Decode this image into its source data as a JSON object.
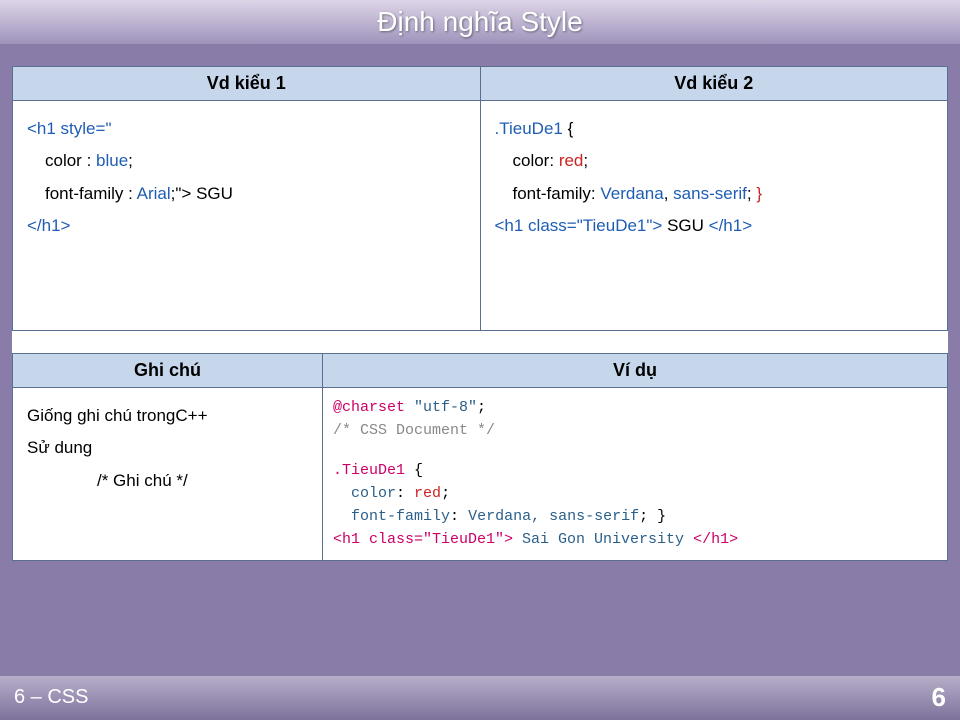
{
  "title": "Định nghĩa Style",
  "footer_left": "6 – CSS",
  "page_number": "6",
  "table1": {
    "h1": "Vd kiểu 1",
    "h2": "Vd kiểu 2",
    "c1": {
      "l1a": "<h1 style=\"",
      "l2a": "color",
      "l2b": " : ",
      "l2c": "blue",
      "l2d": ";",
      "l3a": "font-family",
      "l3b": " : ",
      "l3c": "Arial",
      "l3d": ";\"> SGU",
      "l4a": "</h1>"
    },
    "c2": {
      "l1a": ".TieuDe1 ",
      "l1b": "{",
      "l2a": "color",
      "l2b": ": ",
      "l2c": "red",
      "l2d": ";",
      "l3a": "font-family",
      "l3b": ": ",
      "l3c": "Verdana",
      "l3d": ", ",
      "l3e": "sans-serif",
      "l3f": "; ",
      "l3g": "}",
      "l4a": "<h1 class=\"TieuDe1\">",
      "l4b": " SGU ",
      "l4c": "</h1>"
    }
  },
  "table2": {
    "h1": "Ghi chú",
    "h2": "Ví dụ",
    "c1": {
      "l1": "Giống ghi chú trongC++",
      "l2": "Sử dung",
      "l3": "/* Ghi chú */"
    },
    "c2": {
      "l1a": "@charset",
      "l1b": " \"utf-8\"",
      "l1c": ";",
      "l2": "/* CSS Document */",
      "l3": " ",
      "l4a": ".TieuDe1 ",
      "l4b": "{",
      "l5a": "color",
      "l5b": ": ",
      "l5c": "red",
      "l5d": ";",
      "l6a": "font-family",
      "l6b": ": ",
      "l6c": "Verdana, sans-serif",
      "l6d": "; ",
      "l6e": "}",
      "l7a": "<h1 class=\"TieuDe1\">",
      "l7b": " Sai Gon University ",
      "l7c": "</h1>"
    }
  }
}
